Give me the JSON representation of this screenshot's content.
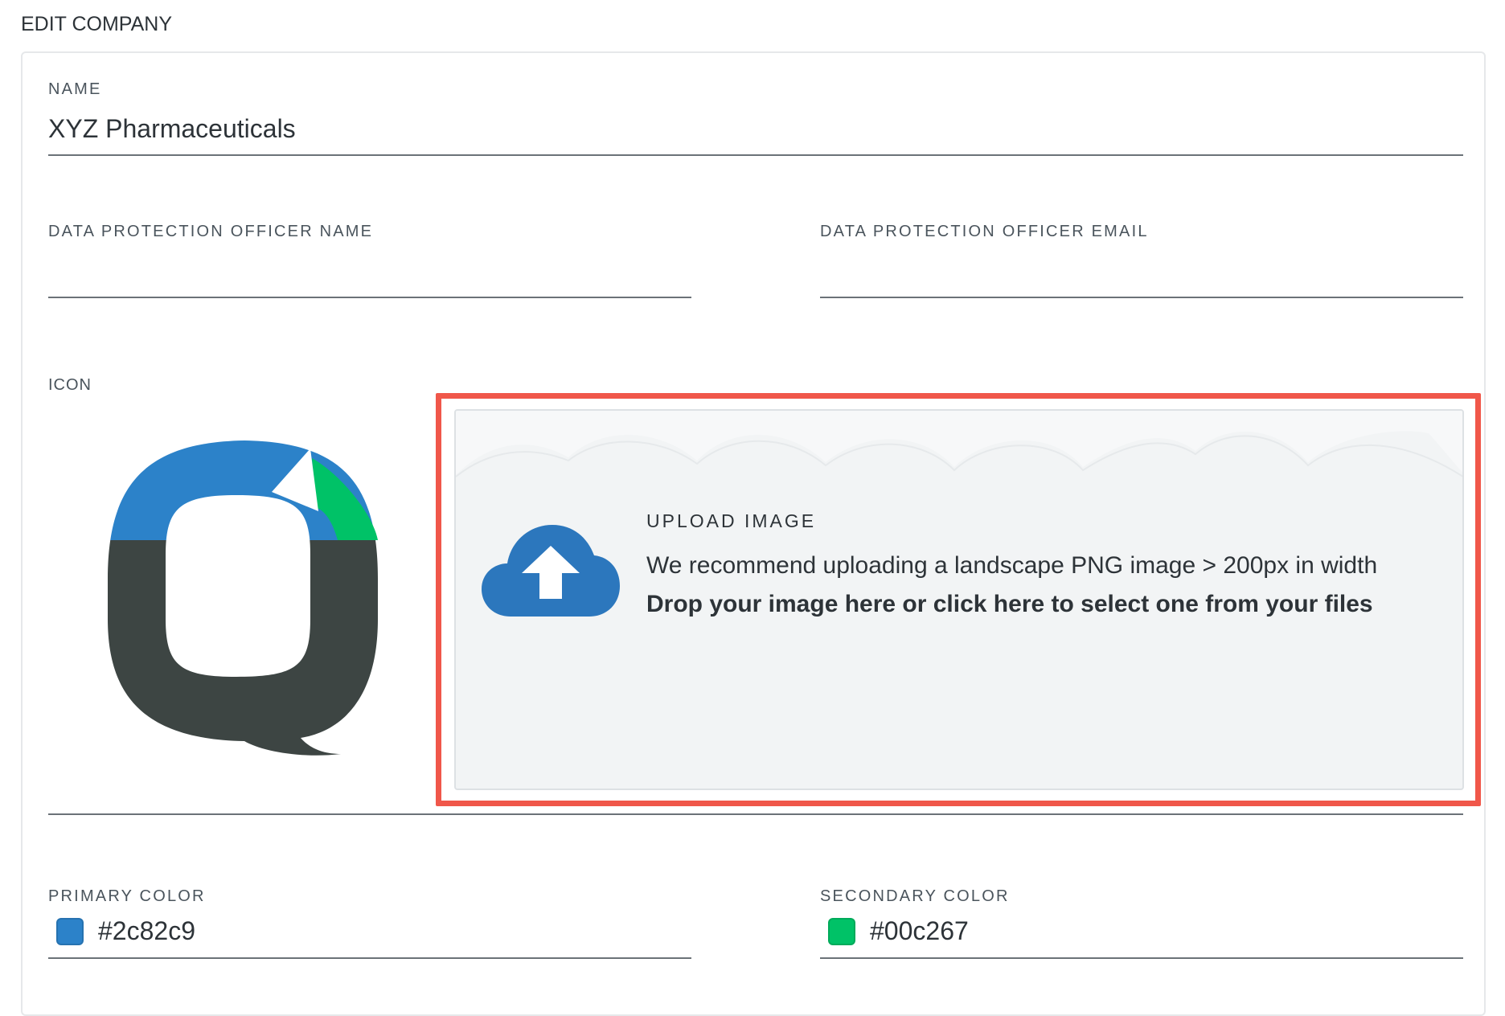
{
  "page": {
    "title": "EDIT COMPANY"
  },
  "form": {
    "name": {
      "label": "NAME",
      "value": "XYZ Pharmaceuticals"
    },
    "dpo_name": {
      "label": "DATA PROTECTION OFFICER NAME",
      "value": ""
    },
    "dpo_email": {
      "label": "DATA PROTECTION OFFICER EMAIL",
      "value": ""
    },
    "icon": {
      "label": "ICON",
      "logo_colors": {
        "top_left": "#2c82c9",
        "top_right": "#00c267",
        "bottom": "#3d4543"
      }
    },
    "upload": {
      "title": "UPLOAD IMAGE",
      "hint": "We recommend uploading a landscape PNG image > 200px in width",
      "cta": "Drop your image here or click here to select one from your files",
      "icon": "cloud-upload-icon",
      "icon_color": "#2c77bd",
      "highlight_color": "#f0574a"
    },
    "primary_color": {
      "label": "PRIMARY COLOR",
      "value": "#2c82c9"
    },
    "secondary_color": {
      "label": "SECONDARY COLOR",
      "value": "#00c267"
    }
  }
}
